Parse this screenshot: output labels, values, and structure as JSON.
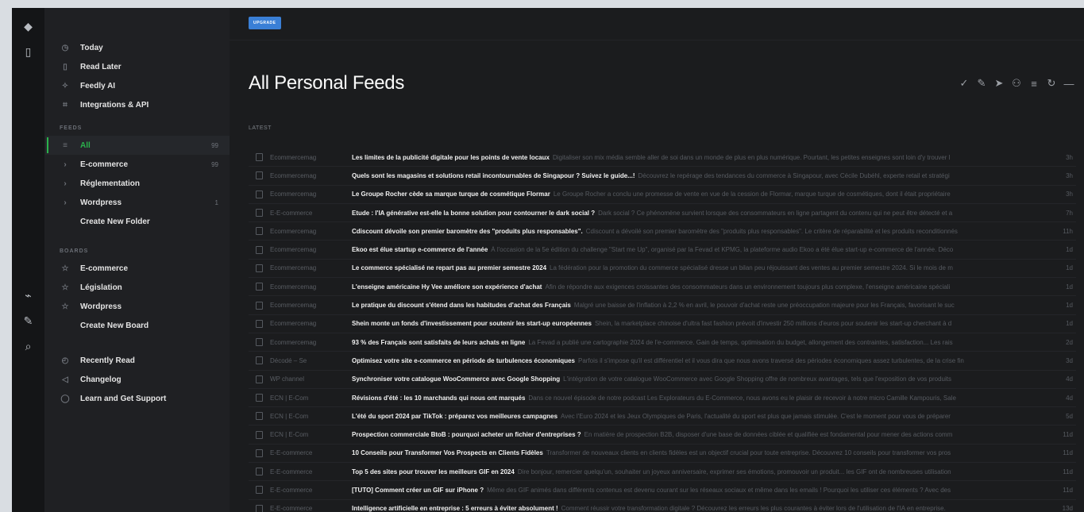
{
  "sidebar": {
    "top_items": [
      {
        "label": "Today",
        "icon": "clock-icon"
      },
      {
        "label": "Read Later",
        "icon": "bookmark-icon"
      },
      {
        "label": "Feedly AI",
        "icon": "sparkle-icon"
      },
      {
        "label": "Integrations & API",
        "icon": "plug-icon"
      }
    ],
    "feeds_label": "FEEDS",
    "feeds": [
      {
        "label": "All",
        "count": "99"
      },
      {
        "label": "E-commerce",
        "count": "99"
      },
      {
        "label": "Réglementation",
        "count": ""
      },
      {
        "label": "Wordpress",
        "count": "1"
      }
    ],
    "create_folder": "Create New Folder",
    "boards_label": "BOARDS",
    "boards": [
      {
        "label": "E-commerce"
      },
      {
        "label": "Législation"
      },
      {
        "label": "Wordpress"
      }
    ],
    "create_board": "Create New Board",
    "bottom_items": [
      {
        "label": "Recently Read",
        "icon": "history-icon"
      },
      {
        "label": "Changelog",
        "icon": "megaphone-icon"
      },
      {
        "label": "Learn and Get Support",
        "icon": "help-icon"
      }
    ]
  },
  "main": {
    "badge": "UPGRADE",
    "title": "All Personal Feeds",
    "latest_label": "LATEST",
    "articles": [
      {
        "source": "Ecommercemag",
        "title": "Les limites de la publicité digitale pour les points de vente locaux",
        "snippet": "Digitaliser son mix média semble aller de soi dans un monde de plus en plus numérique. Pourtant, les petites enseignes sont loin d'y trouver l",
        "age": "3h"
      },
      {
        "source": "Ecommercemag",
        "title": "Quels sont les magasins et solutions retail incontournables de Singapour ? Suivez le guide...!",
        "snippet": "Découvrez le repérage des tendances du commerce à Singapour, avec Cécile Dubéhl, experte retail et stratégi",
        "age": "3h"
      },
      {
        "source": "Ecommercemag",
        "title": "Le Groupe Rocher cède sa marque turque de cosmétique Flormar",
        "snippet": "Le Groupe Rocher a conclu une promesse de vente en vue de la cession de Flormar, marque turque de cosmétiques, dont il était propriétaire",
        "age": "3h"
      },
      {
        "source": "E-E-commerce",
        "title": "Etude : l'IA générative est-elle la bonne solution pour contourner le dark social ?",
        "snippet": "Dark social ? Ce phénomène survient lorsque des consommateurs en ligne partagent du contenu qui ne peut être détecté et a",
        "age": "7h"
      },
      {
        "source": "Ecommercemag",
        "title": "Cdiscount dévoile son premier baromètre des \"produits plus responsables\".",
        "snippet": "Cdiscount a dévoilé son premier baromètre des \"produits plus responsables\". Le critère de réparabilité et les produits reconditionnés",
        "age": "11h"
      },
      {
        "source": "Ecommercemag",
        "title": "Ekoo est élue startup e-commerce de l'année",
        "snippet": "À l'occasion de la 5e édition du challenge \"Start me Up\", organisé par la Fevad et KPMG, la plateforme audio Ekoo a été élue start-up e-commerce de l'année. Déco",
        "age": "1d"
      },
      {
        "source": "Ecommercemag",
        "title": "Le commerce spécialisé ne repart pas au premier semestre 2024",
        "snippet": "La fédération pour la promotion du commerce spécialisé dresse un bilan peu réjouissant des ventes au premier semestre 2024. Si le mois de m",
        "age": "1d"
      },
      {
        "source": "Ecommercemag",
        "title": "L'enseigne américaine Hy Vee améliore son expérience d'achat",
        "snippet": "Afin de répondre aux exigences croissantes des consommateurs dans un environnement toujours plus complexe, l'enseigne américaine spéciali",
        "age": "1d"
      },
      {
        "source": "Ecommercemag",
        "title": "Le pratique du discount s'étend dans les habitudes d'achat des Français",
        "snippet": "Malgré une baisse de l'inflation à 2,2 % en avril, le pouvoir d'achat reste une préoccupation majeure pour les Français, favorisant le suc",
        "age": "1d"
      },
      {
        "source": "Ecommercemag",
        "title": "Shein monte un fonds d'investissement pour soutenir les start-up européennes",
        "snippet": "Shein, la marketplace chinoise d'ultra fast fashion prévoit d'investir 250 millions d'euros pour soutenir les start-up cherchant à d",
        "age": "1d"
      },
      {
        "source": "Ecommercemag",
        "title": "93 % des Français sont satisfaits de leurs achats en ligne",
        "snippet": "La Fevad a publié une cartographie 2024 de l'e-commerce. Gain de temps, optimisation du budget, allongement des contraintes, satisfaction... Les rais",
        "age": "2d"
      },
      {
        "source": "Décodé – Se",
        "title": "Optimisez votre site e-commerce en période de turbulences économiques",
        "snippet": "Parfois il s'impose qu'il est différentiel et il vous dira que nous avons traversé des périodes économiques assez turbulentes, de la crise fin",
        "age": "3d"
      },
      {
        "source": "WP channel",
        "title": "Synchroniser votre catalogue WooCommerce avec Google Shopping",
        "snippet": "L'intégration de votre catalogue WooCommerce avec Google Shopping offre de nombreux avantages, tels que l'exposition de vos produits",
        "age": "4d"
      },
      {
        "source": "ECN | E-Com",
        "title": "Révisions d'été : les 10 marchands qui nous ont marqués",
        "snippet": "Dans ce nouvel épisode de notre podcast Les Explorateurs du E-Commerce, nous avons eu le plaisir de recevoir à notre micro Camille Kampouris, Sale",
        "age": "4d"
      },
      {
        "source": "ECN | E-Com",
        "title": "L'été du sport 2024 par TikTok : préparez vos meilleures campagnes",
        "snippet": "Avec l'Euro 2024 et les Jeux Olympiques de Paris, l'actualité du sport est plus que jamais stimulée. C'est le moment pour vous de préparer",
        "age": "5d"
      },
      {
        "source": "ECN | E-Com",
        "title": "Prospection commerciale BtoB : pourquoi acheter un fichier d'entreprises ?",
        "snippet": "En matière de prospection B2B, disposer d'une base de données ciblée et qualifiée est fondamental pour mener des actions comm",
        "age": "11d"
      },
      {
        "source": "E-E-commerce",
        "title": "10 Conseils pour Transformer Vos Prospects en Clients Fidèles",
        "snippet": "Transformer de nouveaux clients en clients fidèles est un objectif crucial pour toute entreprise. Découvrez 10 conseils pour transformer vos pros",
        "age": "11d"
      },
      {
        "source": "E-E-commerce",
        "title": "Top 5 des sites pour trouver les meilleurs GIF en 2024",
        "snippet": "Dire bonjour, remercier quelqu'un, souhaiter un joyeux anniversaire, exprimer ses émotions, promouvoir un produit... les GIF ont de nombreuses utilisation",
        "age": "11d"
      },
      {
        "source": "E-E-commerce",
        "title": "[TUTO] Comment créer un GIF sur iPhone ?",
        "snippet": "Même des GIF animés dans différents contenus est devenu courant sur les réseaux sociaux et même dans les emails ! Pourquoi les utiliser ces éléments ? Avec des",
        "age": "11d"
      },
      {
        "source": "E-E-commerce",
        "title": "Intelligence artificielle en entreprise : 5 erreurs à éviter absolument !",
        "snippet": "Comment réussir votre transformation digitale ? Découvrez les erreurs les plus courantes à éviter lors de l'utilisation de l'IA en entreprise.",
        "age": "13d"
      }
    ]
  }
}
